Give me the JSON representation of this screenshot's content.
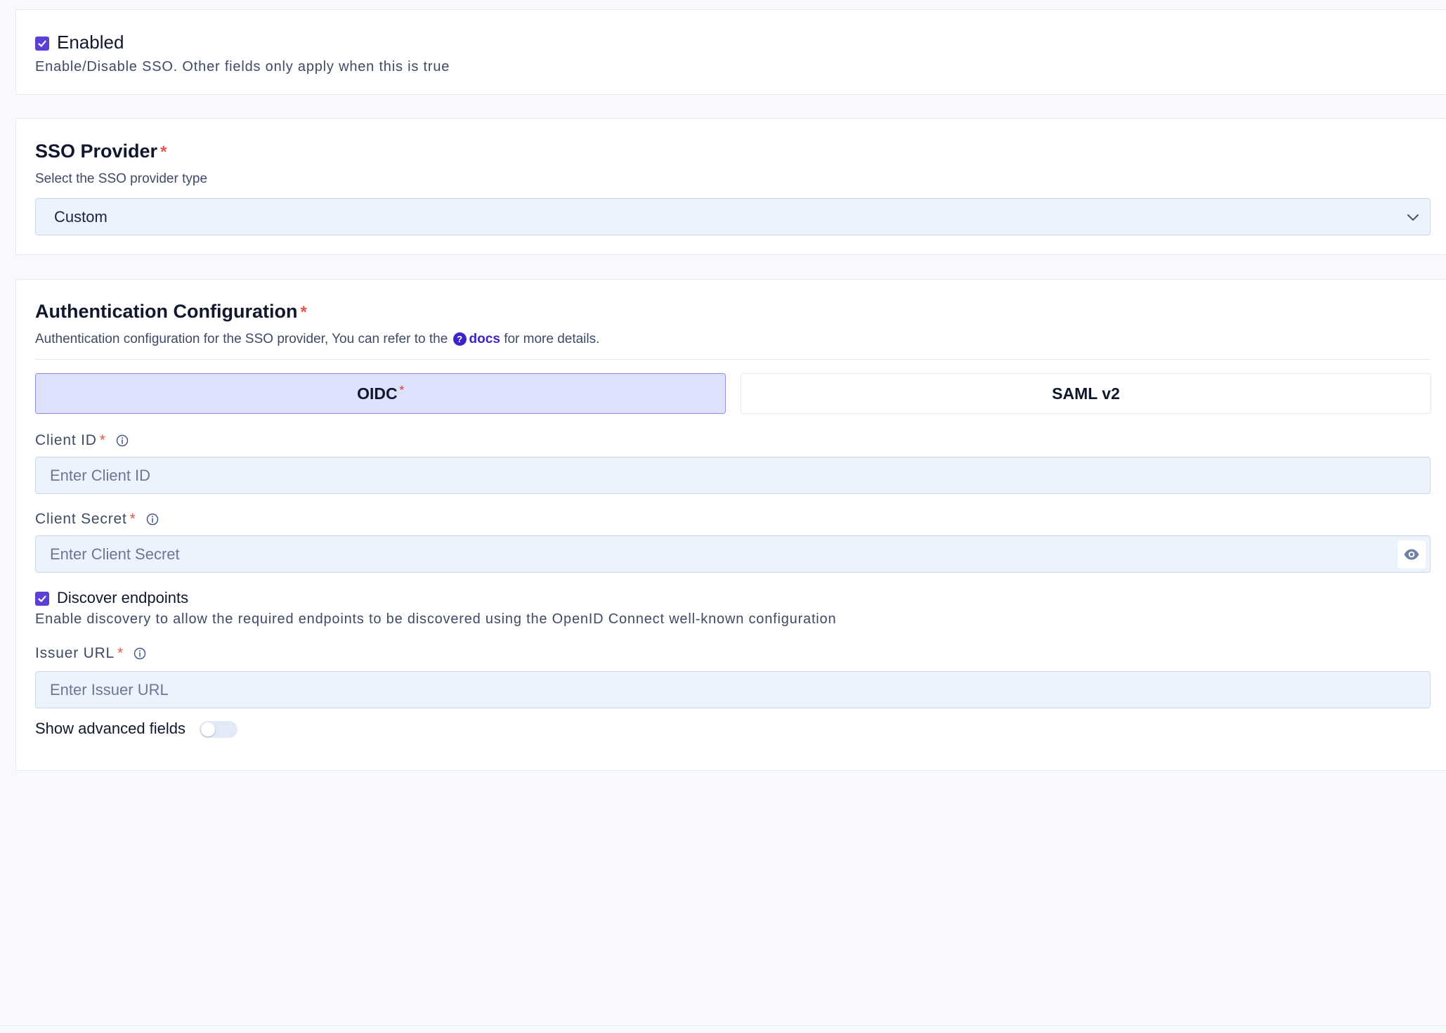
{
  "enabled_section": {
    "checked": true,
    "label": "Enabled",
    "description": "Enable/Disable SSO. Other fields only apply when this is true"
  },
  "provider_section": {
    "title": "SSO Provider",
    "required_mark": "*",
    "description": "Select the SSO provider type",
    "selected_value": "Custom",
    "icon": "chevron-down-icon"
  },
  "auth_section": {
    "title": "Authentication Configuration",
    "required_mark": "*",
    "description_prefix": "Authentication configuration for the SSO provider, You can refer to the",
    "help_icon_glyph": "?",
    "docs_link": "docs",
    "description_suffix": "for more details.",
    "tabs": [
      {
        "label": "OIDC",
        "required_mark": "*",
        "active": true
      },
      {
        "label": "SAML v2",
        "active": false
      }
    ],
    "fields": {
      "client_id": {
        "label": "Client ID",
        "required_mark": "*",
        "placeholder": "Enter Client ID",
        "value": ""
      },
      "client_secret": {
        "label": "Client Secret",
        "required_mark": "*",
        "placeholder": "Enter Client Secret",
        "value": ""
      },
      "issuer_url": {
        "label": "Issuer URL",
        "required_mark": "*",
        "placeholder": "Enter Issuer URL",
        "value": ""
      }
    },
    "discover_endpoints": {
      "checked": true,
      "label": "Discover endpoints",
      "description": "Enable discovery to allow the required endpoints to be discovered using the OpenID Connect well-known configuration"
    },
    "advanced_toggle": {
      "label": "Show advanced fields",
      "on": false
    }
  },
  "colors": {
    "accent": "#5b3fd6",
    "link": "#3b24c9",
    "required": "#e2574c",
    "input_bg": "#edf3fd",
    "tab_active_bg": "#dde1fb"
  }
}
